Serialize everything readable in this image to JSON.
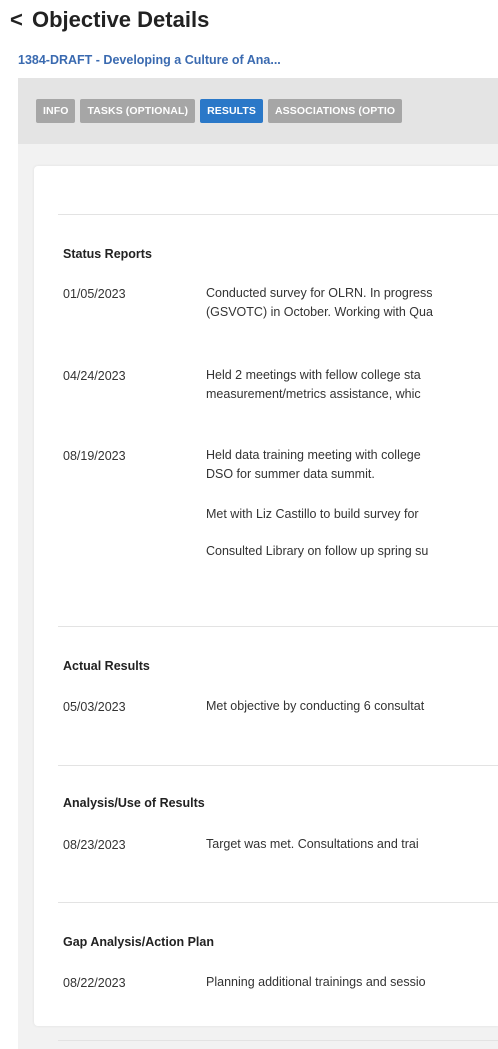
{
  "header": {
    "back_icon": "chevron-left-icon",
    "back_glyph": "<",
    "title": "Objective Details",
    "subtitle": "1384-DRAFT - Developing a Culture of Ana..."
  },
  "tabs": [
    {
      "label": "INFO",
      "active": false
    },
    {
      "label": "TASKS (OPTIONAL)",
      "active": false
    },
    {
      "label": "RESULTS",
      "active": true
    },
    {
      "label": "ASSOCIATIONS (OPTIO",
      "active": false
    }
  ],
  "colors": {
    "accent": "#2a78c8",
    "tab_inactive": "#a6a6a6",
    "subtitle": "#3a6ab0"
  },
  "sections": {
    "status_reports": {
      "title": "Status Reports",
      "rows": [
        {
          "date": "01/05/2023",
          "lines": [
            "Conducted survey for OLRN. In progress",
            "(GSVOTC) in October. Working with Qua"
          ]
        },
        {
          "date": "04/24/2023",
          "lines": [
            "Held 2 meetings with fellow college sta",
            "measurement/metrics assistance, whic"
          ]
        },
        {
          "date": "08/19/2023",
          "lines": [
            "Held data training meeting with college",
            "DSO for summer data summit."
          ]
        },
        {
          "date": "",
          "lines": [
            "Met with Liz Castillo to build survey for"
          ]
        },
        {
          "date": "",
          "lines": [
            "Consulted Library on follow up spring su"
          ]
        }
      ]
    },
    "actual_results": {
      "title": "Actual Results",
      "rows": [
        {
          "date": "05/03/2023",
          "lines": [
            "Met objective by conducting 6 consultat"
          ]
        }
      ]
    },
    "analysis": {
      "title": "Analysis/Use of Results",
      "rows": [
        {
          "date": "08/23/2023",
          "lines": [
            "Target was met. Consultations and trai"
          ]
        }
      ]
    },
    "gap_analysis": {
      "title": "Gap Analysis/Action Plan",
      "rows": [
        {
          "date": "08/22/2023",
          "lines": [
            "Planning additional trainings and sessio"
          ]
        }
      ]
    }
  }
}
